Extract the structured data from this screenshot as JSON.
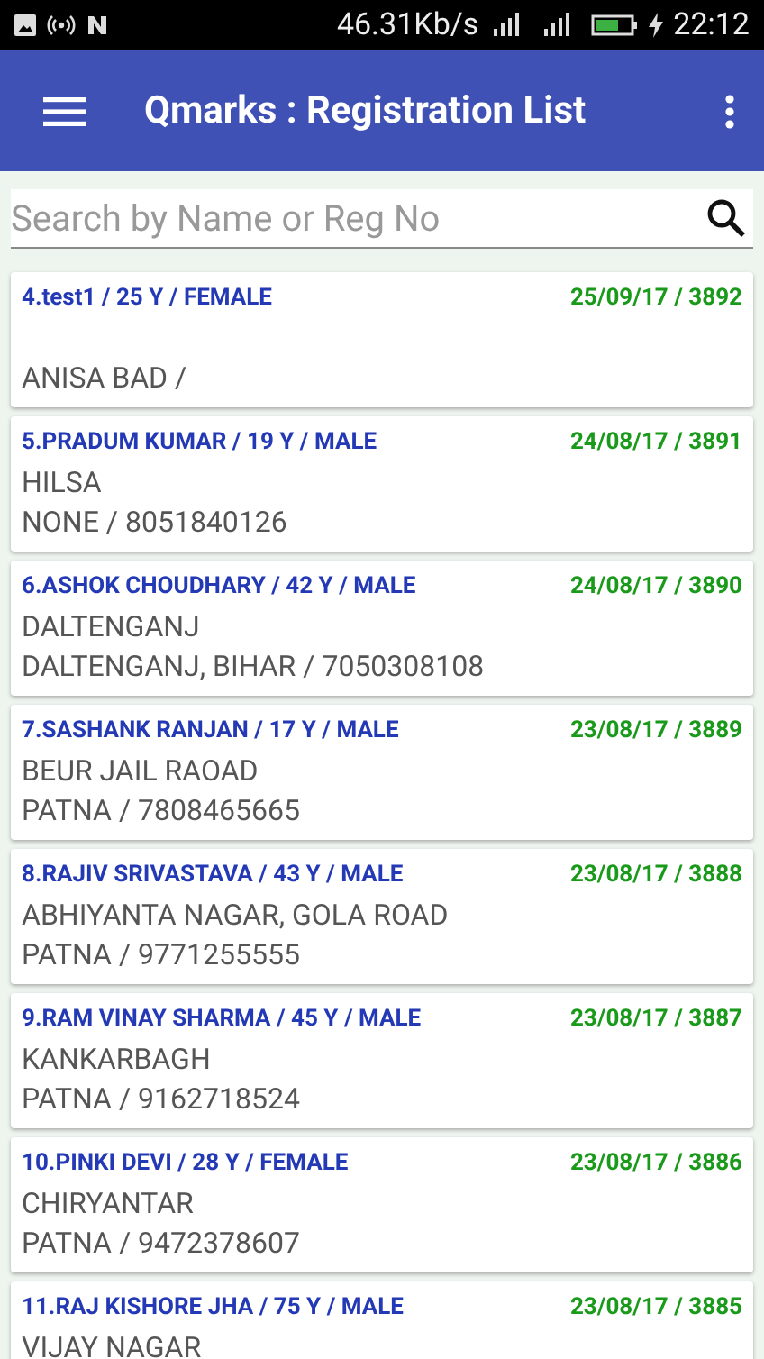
{
  "status_bar": {
    "speed": "46.31Kb/s",
    "time": "22:12"
  },
  "app_bar": {
    "title": "Qmarks : Registration List"
  },
  "search": {
    "placeholder": "Search by Name or Reg No"
  },
  "records": [
    {
      "name": "4.test1 / 25 Y / FEMALE",
      "date": "25/09/17 / 3892",
      "contact": "ANISA BAD /"
    },
    {
      "name": "5.PRADUM KUMAR / 19 Y / MALE",
      "date": "24/08/17 / 3891",
      "address": "HILSA",
      "contact": "NONE / 8051840126"
    },
    {
      "name": "6.ASHOK CHOUDHARY / 42 Y / MALE",
      "date": "24/08/17 / 3890",
      "address": "DALTENGANJ",
      "contact": "DALTENGANJ, BIHAR / 7050308108"
    },
    {
      "name": "7.SASHANK RANJAN / 17 Y / MALE",
      "date": "23/08/17 / 3889",
      "address": "BEUR JAIL RAOAD",
      "contact": "PATNA / 7808465665"
    },
    {
      "name": "8.RAJIV SRIVASTAVA / 43 Y / MALE",
      "date": "23/08/17 / 3888",
      "address": "ABHIYANTA NAGAR, GOLA ROAD",
      "contact": "PATNA / 9771255555"
    },
    {
      "name": "9.RAM VINAY SHARMA / 45 Y / MALE",
      "date": "23/08/17 / 3887",
      "address": "KANKARBAGH",
      "contact": "PATNA / 9162718524"
    },
    {
      "name": "10.PINKI DEVI / 28 Y / FEMALE",
      "date": "23/08/17 / 3886",
      "address": "CHIRYANTAR",
      "contact": "PATNA / 9472378607"
    },
    {
      "name": "11.RAJ KISHORE JHA / 75 Y / MALE",
      "date": "23/08/17 / 3885",
      "address": "VIJAY NAGAR"
    }
  ]
}
